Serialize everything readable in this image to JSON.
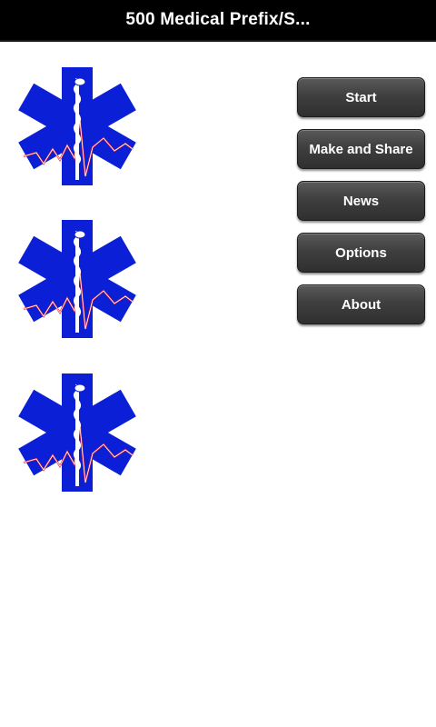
{
  "header": {
    "title": "500 Medical Prefix/S..."
  },
  "logos": [
    {
      "icon": "star-of-life-icon"
    },
    {
      "icon": "star-of-life-icon"
    },
    {
      "icon": "star-of-life-icon"
    }
  ],
  "menu": {
    "start_label": "Start",
    "make_share_label": "Make and Share",
    "news_label": "News",
    "options_label": "Options",
    "about_label": "About"
  },
  "colors": {
    "title_bar": "#000000",
    "star_blue": "#0a1fd6",
    "ecg_red": "#e0202a",
    "button_dark": "#3f3f3f"
  }
}
